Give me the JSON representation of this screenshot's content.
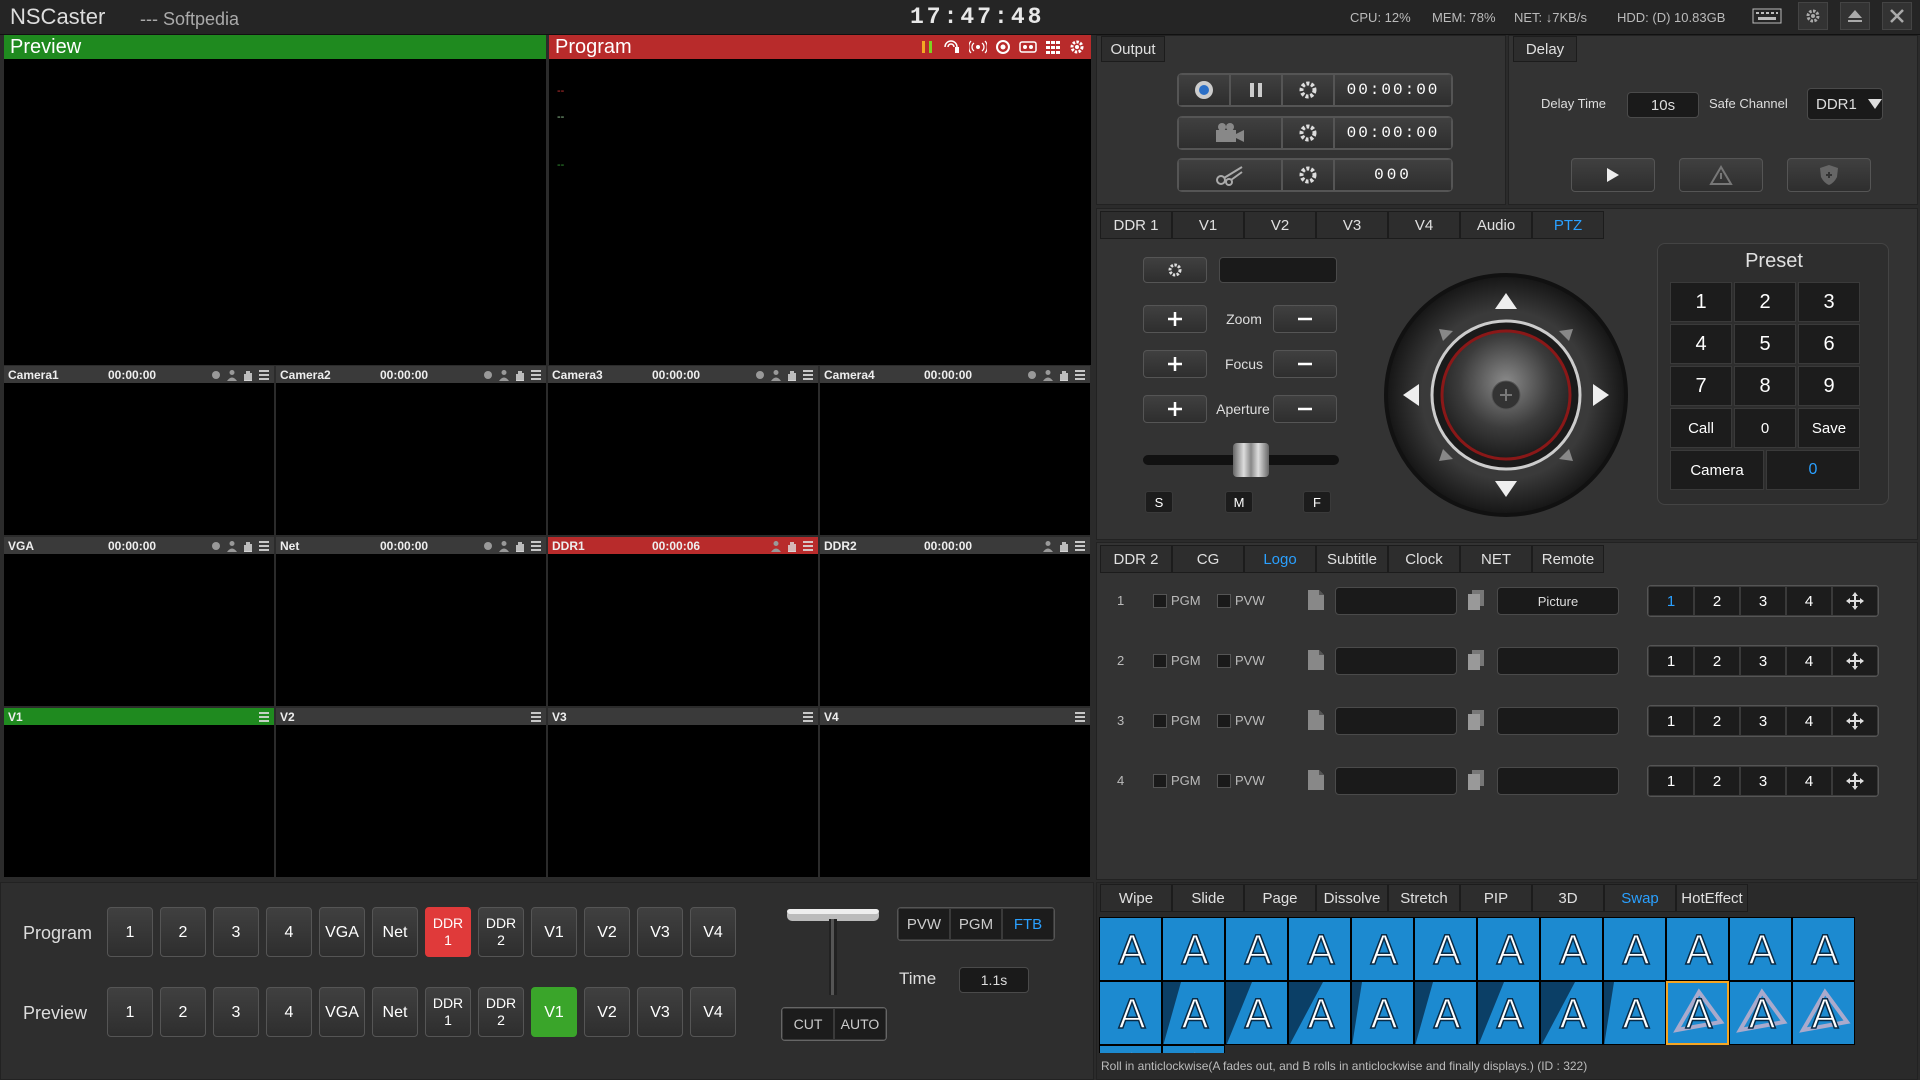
{
  "title_bar": {
    "app_name": "NSCaster",
    "subtitle": "--- Softpedia",
    "clock": "17:47:48",
    "cpu": "CPU:  12%",
    "mem": "MEM:  78%",
    "net": "NET:  ↓7KB/s",
    "hdd": "HDD: (D) 10.83GB"
  },
  "preview": {
    "label": "Preview"
  },
  "program": {
    "label": "Program",
    "overlay_lines": [
      "--",
      "--",
      "--"
    ]
  },
  "tiles": [
    {
      "name": "Camera1",
      "time": "00:00:00"
    },
    {
      "name": "Camera2",
      "time": "00:00:00"
    },
    {
      "name": "Camera3",
      "time": "00:00:00"
    },
    {
      "name": "Camera4",
      "time": "00:00:00"
    },
    {
      "name": "VGA",
      "time": "00:00:00"
    },
    {
      "name": "Net",
      "time": "00:00:00"
    },
    {
      "name": "DDR1",
      "time": "00:00:06"
    },
    {
      "name": "DDR2",
      "time": "00:00:00"
    },
    {
      "name": "V1",
      "time": ""
    },
    {
      "name": "V2",
      "time": ""
    },
    {
      "name": "V3",
      "time": ""
    },
    {
      "name": "V4",
      "time": ""
    }
  ],
  "output": {
    "tab": "Output",
    "rec_time": "00:00:00",
    "stream_time": "00:00:00",
    "clip_count": "000"
  },
  "delay": {
    "tab": "Delay",
    "time_label": "Delay Time",
    "time_value": "10s",
    "safe_label": "Safe Channel",
    "safe_value": "DDR1"
  },
  "source_tabs": [
    "DDR 1",
    "V1",
    "V2",
    "V3",
    "V4",
    "Audio",
    "PTZ"
  ],
  "ptz": {
    "zoom": "Zoom",
    "focus": "Focus",
    "aperture": "Aperture",
    "speed_s": "S",
    "speed_m": "M",
    "speed_f": "F",
    "preset_title": "Preset",
    "keys": [
      "1",
      "2",
      "3",
      "4",
      "5",
      "6",
      "7",
      "8",
      "9"
    ],
    "call": "Call",
    "zero": "0",
    "save": "Save",
    "camera_label": "Camera",
    "camera_value": "0",
    "speed_level": 0.55
  },
  "overlay_tabs": [
    "DDR 2",
    "CG",
    "Logo",
    "Subtitle",
    "Clock",
    "NET",
    "Remote"
  ],
  "logo_rows": [
    {
      "num": "1",
      "pgm": "PGM",
      "pvw": "PVW",
      "picture": "Picture"
    },
    {
      "num": "2",
      "pgm": "PGM",
      "pvw": "PVW",
      "picture": ""
    },
    {
      "num": "3",
      "pgm": "PGM",
      "pvw": "PVW",
      "picture": ""
    },
    {
      "num": "4",
      "pgm": "PGM",
      "pvw": "PVW",
      "picture": ""
    }
  ],
  "pos_buttons": [
    "1",
    "2",
    "3",
    "4"
  ],
  "switcher": {
    "program_label": "Program",
    "preview_label": "Preview",
    "buttons": [
      "1",
      "2",
      "3",
      "4",
      "VGA",
      "Net",
      "DDR\n1",
      "DDR\n2",
      "V1",
      "V2",
      "V3",
      "V4"
    ],
    "pvw": "PVW",
    "pgm": "PGM",
    "ftb": "FTB",
    "time_label": "Time",
    "time_value": "1.1s",
    "cut": "CUT",
    "auto": "AUTO"
  },
  "transition_tabs": [
    "Wipe",
    "Slide",
    "Page",
    "Dissolve",
    "Stretch",
    "PIP",
    "3D",
    "Swap",
    "HotEffect"
  ],
  "transition_glyph": "A",
  "status_text": "Roll in anticlockwise(A fades out, and B rolls in anticlockwise and finally displays.) (ID : 322)",
  "colors": {
    "preview": "#1f8a1f",
    "program": "#b82b2b",
    "active_tab": "#2aa0ff",
    "active_program_btn": "#e03a3a",
    "active_preview_btn": "#3aa52a"
  }
}
